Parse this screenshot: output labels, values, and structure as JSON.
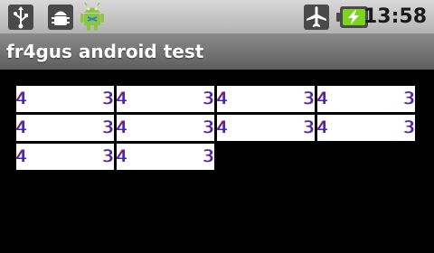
{
  "status_bar": {
    "icons": [
      "usb-icon",
      "debug-icon",
      "android-icon",
      "airplane-mode-icon",
      "battery-charging-icon"
    ],
    "time": "13:58"
  },
  "title_bar": {
    "title": "fr4gus android test"
  },
  "cells": [
    {
      "left": "4",
      "right": "3"
    },
    {
      "left": "4",
      "right": "3"
    },
    {
      "left": "4",
      "right": "3"
    },
    {
      "left": "4",
      "right": "3"
    },
    {
      "left": "4",
      "right": "3"
    },
    {
      "left": "4",
      "right": "3"
    },
    {
      "left": "4",
      "right": "3"
    },
    {
      "left": "4",
      "right": "3"
    },
    {
      "left": "4",
      "right": "3"
    },
    {
      "left": "4",
      "right": "3"
    }
  ],
  "colors": {
    "text_primary": "#2a2ad8",
    "text_secondary": "#dd2222",
    "cell_background": "#ffffff",
    "content_background": "#000000"
  }
}
